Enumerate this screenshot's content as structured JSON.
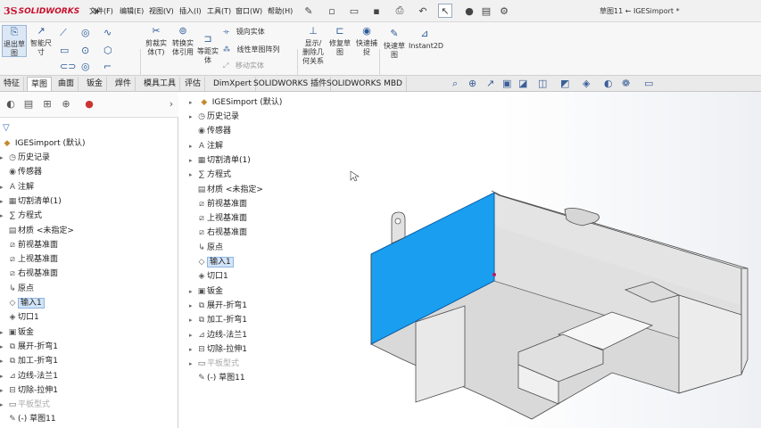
{
  "titlebar": {
    "logo_ds": "3S",
    "logo_text": "SOLIDWORKS",
    "menus": [
      "文件(F)",
      "编辑(E)",
      "视图(V)",
      "插入(I)",
      "工具(T)",
      "窗口(W)",
      "帮助(H)"
    ],
    "document_title": "草图11 ← IGESimport *"
  },
  "commands": {
    "exit_sketch": "退出草\n图",
    "smart_dim": "智能尺\n寸",
    "trim": "剪裁实\n体(T)",
    "convert": "转换实\n体引用",
    "offset": "等距实\n体",
    "mirror": "镜向实体",
    "linear_pattern": "线性草图阵列",
    "move": "移动实体",
    "show_relations": "显示/\n删除几\n何关系",
    "repair": "修复草\n图",
    "quick_snap": "快速捕\n捉",
    "rapid_sketch": "快速草\n图",
    "instant2d": "Instant2D"
  },
  "tabs": [
    "特征",
    "草图",
    "曲面",
    "钣金",
    "焊件",
    "模具工具",
    "评估",
    "DimXpert",
    "SOLIDWORKS 插件",
    "SOLIDWORKS MBD"
  ],
  "active_tab": "草图",
  "left_tree": {
    "root": "IGESimport (默认)",
    "items": [
      {
        "label": "历史记录",
        "icon": "history-icon"
      },
      {
        "label": "传感器",
        "icon": "sensor-icon"
      },
      {
        "label": "注解",
        "icon": "annotation-icon"
      },
      {
        "label": "切割清单(1)",
        "icon": "cutlist-icon"
      },
      {
        "label": "方程式",
        "icon": "equation-icon"
      },
      {
        "label": "材质 <未指定>",
        "icon": "material-icon"
      },
      {
        "label": "前视基准面",
        "icon": "plane-icon"
      },
      {
        "label": "上视基准面",
        "icon": "plane-icon"
      },
      {
        "label": "右视基准面",
        "icon": "plane-icon"
      },
      {
        "label": "原点",
        "icon": "origin-icon"
      },
      {
        "label": "输入1",
        "icon": "import-icon"
      },
      {
        "label": "切口1",
        "icon": "rip-icon"
      },
      {
        "label": "钣金",
        "icon": "sheetmetal-icon"
      },
      {
        "label": "展开-折弯1",
        "icon": "unfold-icon"
      },
      {
        "label": "加工-折弯1",
        "icon": "process-bend-icon"
      },
      {
        "label": "边线-法兰1",
        "icon": "edge-flange-icon"
      },
      {
        "label": "切除-拉伸1",
        "icon": "cut-extrude-icon"
      },
      {
        "label": "平板型式",
        "icon": "flat-pattern-icon"
      },
      {
        "label": "(-) 草图11",
        "icon": "sketch-icon"
      }
    ]
  },
  "viewport_tree": {
    "root": "IGESimport (默认)"
  },
  "colors": {
    "accent": "#2c5b9a",
    "selected_face": "#1a9ff0",
    "selection_bg": "#d2e4f8"
  }
}
